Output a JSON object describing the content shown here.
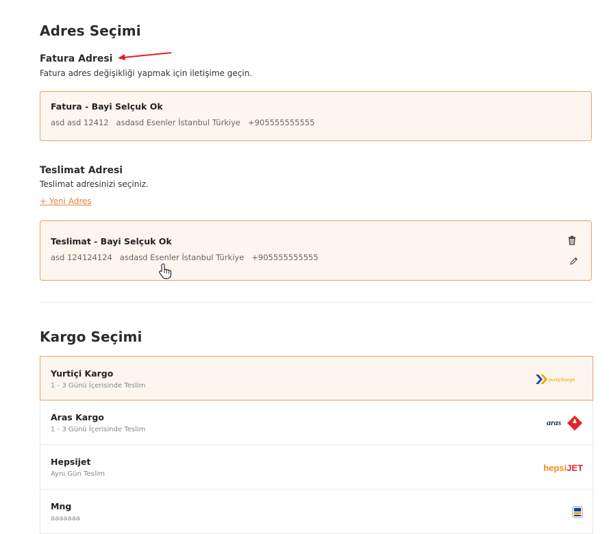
{
  "address_section": {
    "title": "Adres Seçimi",
    "invoice": {
      "title": "Fatura Adresi",
      "description": "Fatura adres değişikliği yapmak için iletişime geçin.",
      "card": {
        "name": "Fatura - Bayi Selçuk Ok",
        "detail": "asd asd 12412   asdasd Esenler İstanbul Türkiye   +905555555555"
      }
    },
    "delivery": {
      "title": "Teslimat Adresi",
      "description": "Teslimat adresinizi seçiniz.",
      "new_address_link": "+ Yeni Adres",
      "card": {
        "name": "Teslimat - Bayi Selçuk Ok",
        "detail": "asd 124124124   asdasd Esenler İstanbul Türkiye   +905555555555",
        "delete_icon": "trash-icon",
        "edit_icon": "pencil-icon"
      }
    }
  },
  "cargo_section": {
    "title": "Kargo Seçimi",
    "items": [
      {
        "name": "Yurtiçi Kargo",
        "desc": "1 - 3 Günü İçerisinde Teslim",
        "selected": true,
        "logo": "yurtici-kargo-logo",
        "logo_text": "yurtiçikargo"
      },
      {
        "name": "Aras Kargo",
        "desc": "1 - 3 Günü İçerisinde Teslim",
        "selected": false,
        "logo": "aras-kargo-logo",
        "logo_text": "aras"
      },
      {
        "name": "Hepsijet",
        "desc": "Aynı Gün Teslim",
        "selected": false,
        "logo": "hepsijet-logo",
        "logo_text_1": "hepsi",
        "logo_text_2": "JET"
      },
      {
        "name": "Mng",
        "desc": "aaaaaaa",
        "selected": false,
        "logo": "mng-logo"
      }
    ]
  },
  "colors": {
    "accent": "#e8803a",
    "card_bg": "#fdf6ef",
    "card_border": "#e9a066",
    "annotation_arrow": "#e02020"
  }
}
